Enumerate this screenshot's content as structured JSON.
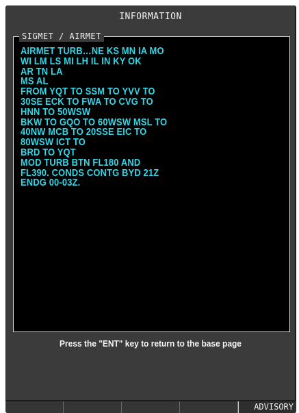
{
  "screen": {
    "title": "INFORMATION"
  },
  "panel": {
    "label": "SIGMET / AIRMET",
    "message_lines": [
      "AIRMET TURB…NE KS MN IA MO",
      "WI LM LS MI LH IL IN KY OK",
      "AR TN LA",
      "MS AL",
      "FROM YQT TO SSM TO YVV TO",
      "30SE ECK TO FWA TO CVG TO",
      "HNN TO 50WSW",
      "BKW TO GQO TO 60WSW MSL TO",
      "40NW MCB TO 20SSE EIC TO",
      "80WSW ICT TO",
      "BRD TO YQT",
      "MOD TURB BTN FL180 AND",
      "FL390. CONDS CONTG BYD 21Z",
      "ENDG 00-03Z."
    ],
    "text_color": "#33d6e6"
  },
  "footer": {
    "note": "Press the \"ENT\" key to return to the base page"
  },
  "softkeys": [
    {
      "label": ""
    },
    {
      "label": ""
    },
    {
      "label": ""
    },
    {
      "label": ""
    },
    {
      "label": "ADVISORY"
    }
  ]
}
